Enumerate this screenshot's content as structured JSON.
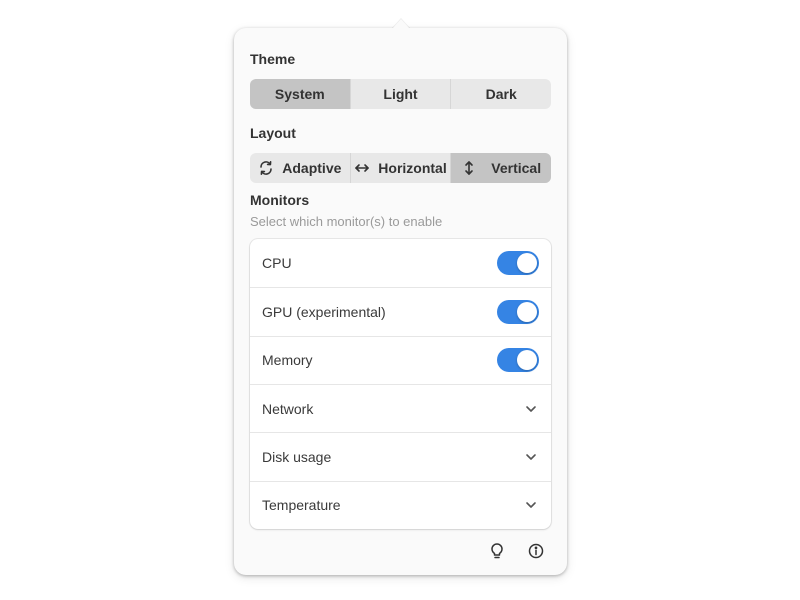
{
  "theme": {
    "title": "Theme",
    "options": [
      {
        "label": "System",
        "active": true
      },
      {
        "label": "Light",
        "active": false
      },
      {
        "label": "Dark",
        "active": false
      }
    ]
  },
  "layout": {
    "title": "Layout",
    "options": [
      {
        "label": "Adaptive",
        "icon": "adaptive-icon",
        "active": false
      },
      {
        "label": "Horizontal",
        "icon": "horizontal-arrows-icon",
        "active": false
      },
      {
        "label": "Vertical",
        "icon": "vertical-arrows-icon",
        "active": true
      }
    ]
  },
  "monitors": {
    "title": "Monitors",
    "subtitle": "Select which monitor(s) to enable",
    "items": [
      {
        "label": "CPU",
        "control": "toggle",
        "enabled": true
      },
      {
        "label": "GPU (experimental)",
        "control": "toggle",
        "enabled": true
      },
      {
        "label": "Memory",
        "control": "toggle",
        "enabled": true
      },
      {
        "label": "Network",
        "control": "expander"
      },
      {
        "label": "Disk usage",
        "control": "expander"
      },
      {
        "label": "Temperature",
        "control": "expander"
      }
    ]
  },
  "footer": {
    "icons": [
      "lightbulb-icon",
      "info-icon"
    ]
  },
  "colors": {
    "accent": "#3584e4",
    "active_segment": "#c4c4c4",
    "segment_bg": "#e8e8e8"
  }
}
